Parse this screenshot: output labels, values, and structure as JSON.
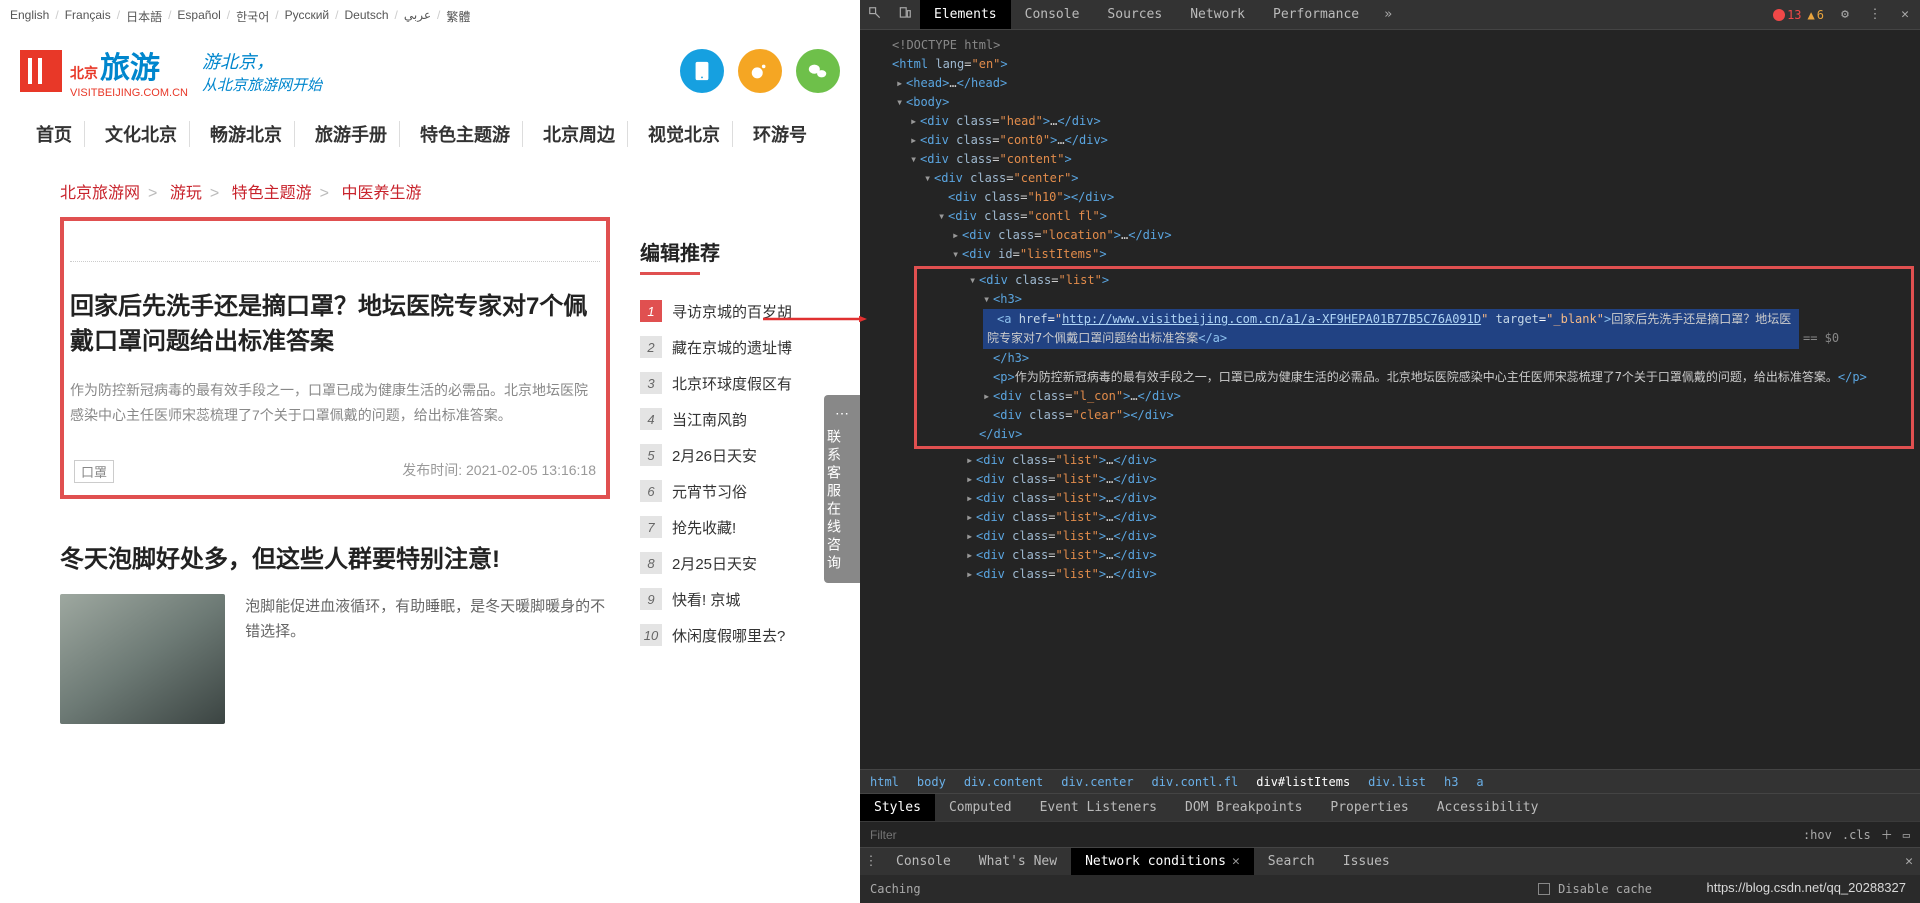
{
  "langs": [
    "English",
    "Français",
    "日本語",
    "Español",
    "한국어",
    "Русский",
    "Deutsch",
    "عربي",
    "繁體"
  ],
  "logo": {
    "brand_small": "北京",
    "brand_big": "旅游",
    "domain": "VISITBEIJING.COM.CN",
    "slogan1": "游北京，",
    "slogan2": "从北京旅游网开始"
  },
  "nav": [
    "首页",
    "文化北京",
    "畅游北京",
    "旅游手册",
    "特色主题游",
    "北京周边",
    "视觉北京",
    "环游号"
  ],
  "breadcrumb": {
    "a": "北京旅游网",
    "b": "游玩",
    "c": "特色主题游",
    "d": "中医养生游"
  },
  "article": {
    "title": "回家后先洗手还是摘口罩？地坛医院专家对7个佩戴口罩问题给出标准答案",
    "desc": "作为防控新冠病毒的最有效手段之一，口罩已成为健康生活的必需品。北京地坛医院感染中心主任医师宋蕊梳理了7个关于口罩佩戴的问题，给出标准答案。",
    "tag": "口罩",
    "pub_label": "发布时间:",
    "pub_value": "2021-02-05  13:16:18"
  },
  "article2": {
    "title": "冬天泡脚好处多，但这些人群要特别注意!",
    "desc": "泡脚能促进血液循环，有助睡眠，是冬天暖脚暖身的不错选择。"
  },
  "side": {
    "title": "编辑推荐",
    "items": [
      "寻访京城的百岁胡",
      "藏在京城的遗址博",
      "北京环球度假区有",
      "当江南风韵",
      "2月26日天安",
      "元宵节习俗",
      "抢先收藏!",
      "2月25日天安",
      "快看! 京城",
      "休闲度假哪里去?"
    ]
  },
  "support": "联系客服在线咨询",
  "devtools": {
    "tabs": [
      "Elements",
      "Console",
      "Sources",
      "Network",
      "Performance"
    ],
    "errors": "13",
    "warns": "6",
    "doctype": "<!DOCTYPE html>",
    "html_lang": "en",
    "href_url": "http://www.visitbeijing.com.cn/a1/a-XF9HEPA01B77B5C76A091D",
    "link_text": "回家后先洗手还是摘口罩？地坛医院专家对7个佩戴口罩问题给出标准答案",
    "p_text": "作为防控新冠病毒的最有效手段之一，口罩已成为健康生活的必需品。北京地坛医院感染中心主任医师宋蕊梳理了7个关于口罩佩戴的问题，给出标准答案。",
    "crumbs": [
      "html",
      "body",
      "div.content",
      "div.center",
      "div.contl.fl",
      "div#listItems",
      "div.list",
      "h3",
      "a"
    ],
    "styles_tabs": [
      "Styles",
      "Computed",
      "Event Listeners",
      "DOM Breakpoints",
      "Properties",
      "Accessibility"
    ],
    "filter_placeholder": "Filter",
    "hov": ":hov",
    "cls": ".cls",
    "drawer_tabs": [
      "Console",
      "What's New",
      "Network conditions",
      "Search",
      "Issues"
    ],
    "caching": "Caching",
    "disable_cache": "Disable cache"
  },
  "watermark": "https://blog.csdn.net/qq_20288327"
}
